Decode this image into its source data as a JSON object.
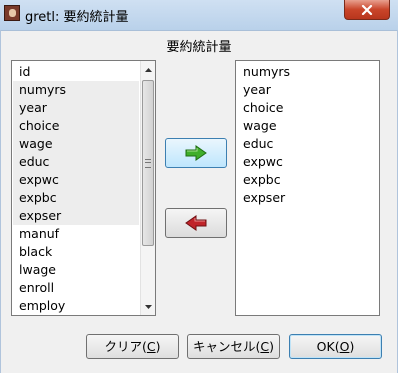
{
  "window": {
    "title": "gretl: 要約統計量",
    "close_glyph": "✕"
  },
  "dialog": {
    "heading": "要約統計量"
  },
  "available_list": {
    "items": [
      {
        "label": "id",
        "selected": false
      },
      {
        "label": "numyrs",
        "selected": true
      },
      {
        "label": "year",
        "selected": true
      },
      {
        "label": "choice",
        "selected": true
      },
      {
        "label": "wage",
        "selected": true
      },
      {
        "label": "educ",
        "selected": true
      },
      {
        "label": "expwc",
        "selected": true
      },
      {
        "label": "expbc",
        "selected": true
      },
      {
        "label": "expser",
        "selected": true
      },
      {
        "label": "manuf",
        "selected": false
      },
      {
        "label": "black",
        "selected": false
      },
      {
        "label": "lwage",
        "selected": false
      },
      {
        "label": "enroll",
        "selected": false
      },
      {
        "label": "employ",
        "selected": false
      }
    ]
  },
  "selected_list": {
    "items": [
      "numyrs",
      "year",
      "choice",
      "wage",
      "educ",
      "expwc",
      "expbc",
      "expser"
    ]
  },
  "transfer_buttons": {
    "add_icon": "green-right-arrow-icon",
    "remove_icon": "red-left-arrow-icon",
    "add_color": "#3fae2a",
    "remove_color": "#c0242a"
  },
  "buttons": {
    "clear": {
      "prefix": "クリア(",
      "mnemonic": "C",
      "suffix": ")"
    },
    "cancel": {
      "prefix": "キャンセル(",
      "mnemonic": "C",
      "suffix": ")"
    },
    "ok": {
      "prefix": "OK(",
      "mnemonic": "O",
      "suffix": ")"
    }
  }
}
